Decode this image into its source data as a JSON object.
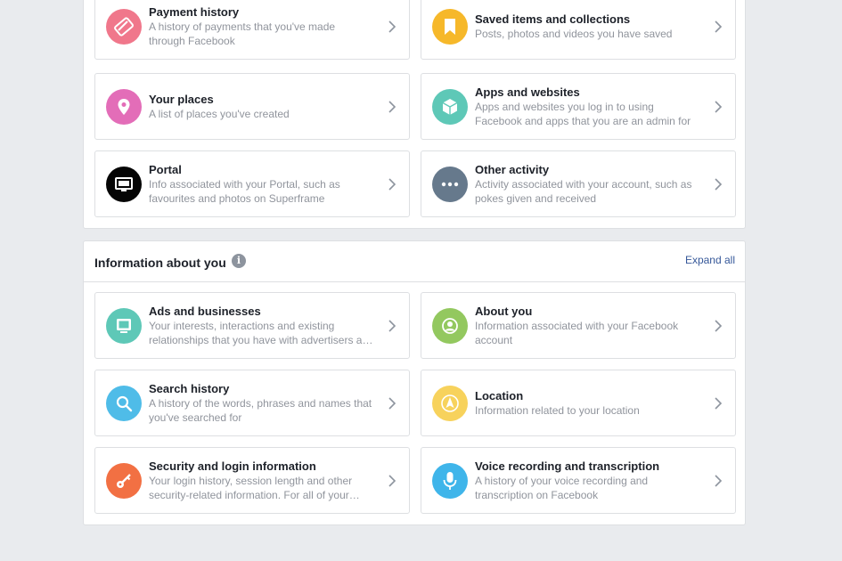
{
  "top_section": {
    "cards": [
      {
        "title": "Payment history",
        "desc": "A history of payments that you've made through Facebook",
        "icon": "credit-card-icon",
        "color": "#f0778b"
      },
      {
        "title": "Saved items and collections",
        "desc": "Posts, photos and videos you have saved",
        "icon": "bookmark-icon",
        "color": "#f6b82a"
      },
      {
        "title": "Your places",
        "desc": "A list of places you've created",
        "icon": "map-pin-icon",
        "color": "#e36db8"
      },
      {
        "title": "Apps and websites",
        "desc": "Apps and websites you log in to using Facebook and apps that you are an admin for",
        "icon": "cube-icon",
        "color": "#5ec8b7"
      },
      {
        "title": "Portal",
        "desc": "Info associated with your Portal, such as favourites and photos on Superframe",
        "icon": "portal-icon",
        "color": "#050505"
      },
      {
        "title": "Other activity",
        "desc": "Activity associated with your account, such as pokes given and received",
        "icon": "more-dots-icon",
        "color": "#66798c"
      }
    ]
  },
  "info_section": {
    "title": "Information about you",
    "info_glyph": "i",
    "expand_label": "Expand all",
    "cards": [
      {
        "title": "Ads and businesses",
        "desc": "Your interests, interactions and existing relationships that you have with advertisers a…",
        "icon": "monitor-icon",
        "color": "#5ec8b7"
      },
      {
        "title": "About you",
        "desc": "Information associated with your Facebook account",
        "icon": "person-icon",
        "color": "#93c85f"
      },
      {
        "title": "Search history",
        "desc": "A history of the words, phrases and names that you've searched for",
        "icon": "search-icon",
        "color": "#4fbce8"
      },
      {
        "title": "Location",
        "desc": "Information related to your location",
        "icon": "location-arrow-icon",
        "color": "#f7d25c"
      },
      {
        "title": "Security and login information",
        "desc": "Your login history, session length and other security-related information. For all of your…",
        "icon": "key-icon",
        "color": "#f27043"
      },
      {
        "title": "Voice recording and transcription",
        "desc": "A history of your voice recording and transcription on Facebook",
        "icon": "microphone-icon",
        "color": "#3fb5ea"
      }
    ]
  }
}
